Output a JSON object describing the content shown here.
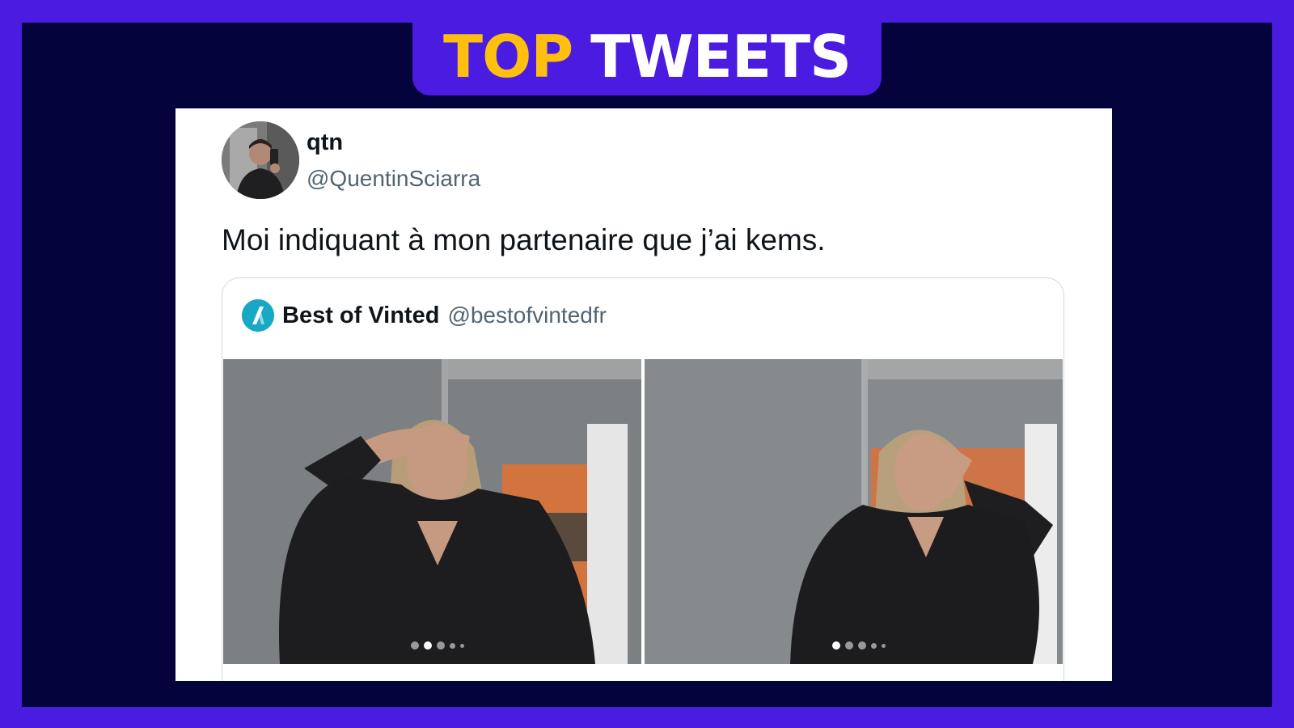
{
  "banner": {
    "word1": "TOP",
    "word2": "TWEETS"
  },
  "colors": {
    "frame_purple": "#4a1be0",
    "navy": "#05033b",
    "gold": "#ffbf0f",
    "logo_teal": "#17a8c4"
  },
  "tweet": {
    "display_name": "qtn",
    "handle": "@QuentinSciarra",
    "text": "Moi indiquant à mon partenaire que j’ai kems.",
    "avatar_icon": "profile-photo",
    "quote": {
      "logo_icon": "vinted-logo",
      "name": "Best of Vinted",
      "handle": "@bestofvintedfr",
      "media": [
        {
          "description_icon": "photo-woman-covering-eyes",
          "carousel_active": 2,
          "carousel_count": 5
        },
        {
          "description_icon": "photo-woman-covering-face",
          "carousel_active": 1,
          "carousel_count": 5
        }
      ]
    }
  }
}
